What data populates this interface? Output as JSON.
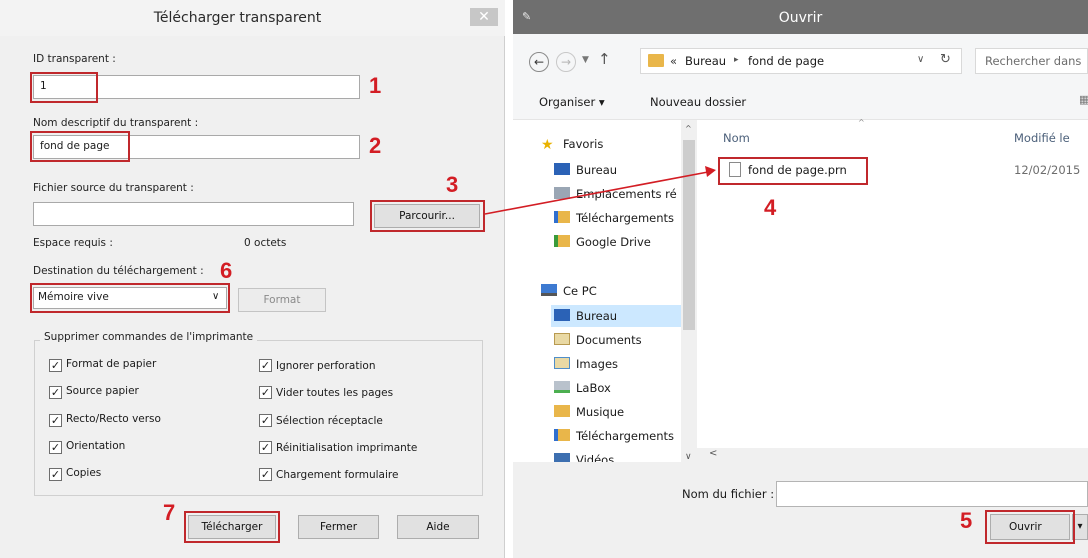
{
  "upload_dialog": {
    "title": "Télécharger transparent",
    "close_label": "✕",
    "id_label": "ID transparent :",
    "id_value": "1",
    "name_label": "Nom descriptif du transparent :",
    "name_value": "fond de page",
    "source_label": "Fichier source du transparent :",
    "source_value": "",
    "browse_button": "Parcourir...",
    "space_label": "Espace requis :",
    "space_value": "0  octets",
    "destination_label": "Destination du téléchargement :",
    "destination_value": "Mémoire vive",
    "format_button": "Format",
    "group_title": "Supprimer commandes de l'imprimante",
    "checkboxes_left": [
      {
        "label": "Format de papier",
        "checked": true
      },
      {
        "label": "Source papier",
        "checked": true
      },
      {
        "label": "Recto/Recto verso",
        "checked": true
      },
      {
        "label": "Orientation",
        "checked": true
      },
      {
        "label": "Copies",
        "checked": true
      }
    ],
    "checkboxes_right": [
      {
        "label": "Ignorer perforation",
        "checked": true
      },
      {
        "label": "Vider toutes les pages",
        "checked": true
      },
      {
        "label": "Sélection réceptacle",
        "checked": true
      },
      {
        "label": "Réinitialisation imprimante",
        "checked": true
      },
      {
        "label": "Chargement formulaire",
        "checked": true
      }
    ],
    "download_button": "Télécharger",
    "close_button": "Fermer",
    "help_button": "Aide"
  },
  "open_dialog": {
    "title": "Ouvrir",
    "address": {
      "prefix": "«",
      "crumb_1": "Bureau",
      "separator": "▸",
      "crumb_2": "fond de page"
    },
    "search_placeholder": "Rechercher dans",
    "organize_label": "Organiser ▾",
    "new_folder_label": "Nouveau dossier",
    "nav_favorites": [
      {
        "label": "Favoris",
        "icon": "star-icon"
      },
      {
        "label": "Bureau",
        "icon": "desktop-icon"
      },
      {
        "label": "Emplacements ré",
        "icon": "recent-places-icon"
      },
      {
        "label": "Téléchargements",
        "icon": "downloads-icon"
      },
      {
        "label": "Google Drive",
        "icon": "google-drive-icon"
      }
    ],
    "nav_pc": [
      {
        "label": "Ce PC",
        "icon": "computer-icon"
      },
      {
        "label": "Bureau",
        "icon": "desktop-icon"
      },
      {
        "label": "Documents",
        "icon": "documents-icon"
      },
      {
        "label": "Images",
        "icon": "images-icon"
      },
      {
        "label": "LaBox",
        "icon": "network-drive-icon"
      },
      {
        "label": "Musique",
        "icon": "music-icon"
      },
      {
        "label": "Téléchargements",
        "icon": "downloads-icon"
      },
      {
        "label": "Vidéos",
        "icon": "videos-icon"
      }
    ],
    "columns": {
      "name": "Nom",
      "modified": "Modifié le"
    },
    "file": {
      "name": "fond de page.prn",
      "modified": "12/02/2015"
    },
    "filename_label": "Nom du fichier :",
    "filename_value": "",
    "open_button": "Ouvrir"
  },
  "markers": [
    "1",
    "2",
    "3",
    "4",
    "5",
    "6",
    "7"
  ],
  "colors": {
    "marker": "#d31d24",
    "title_bar": "#6f6f6f",
    "selected": "#cce8ff"
  }
}
